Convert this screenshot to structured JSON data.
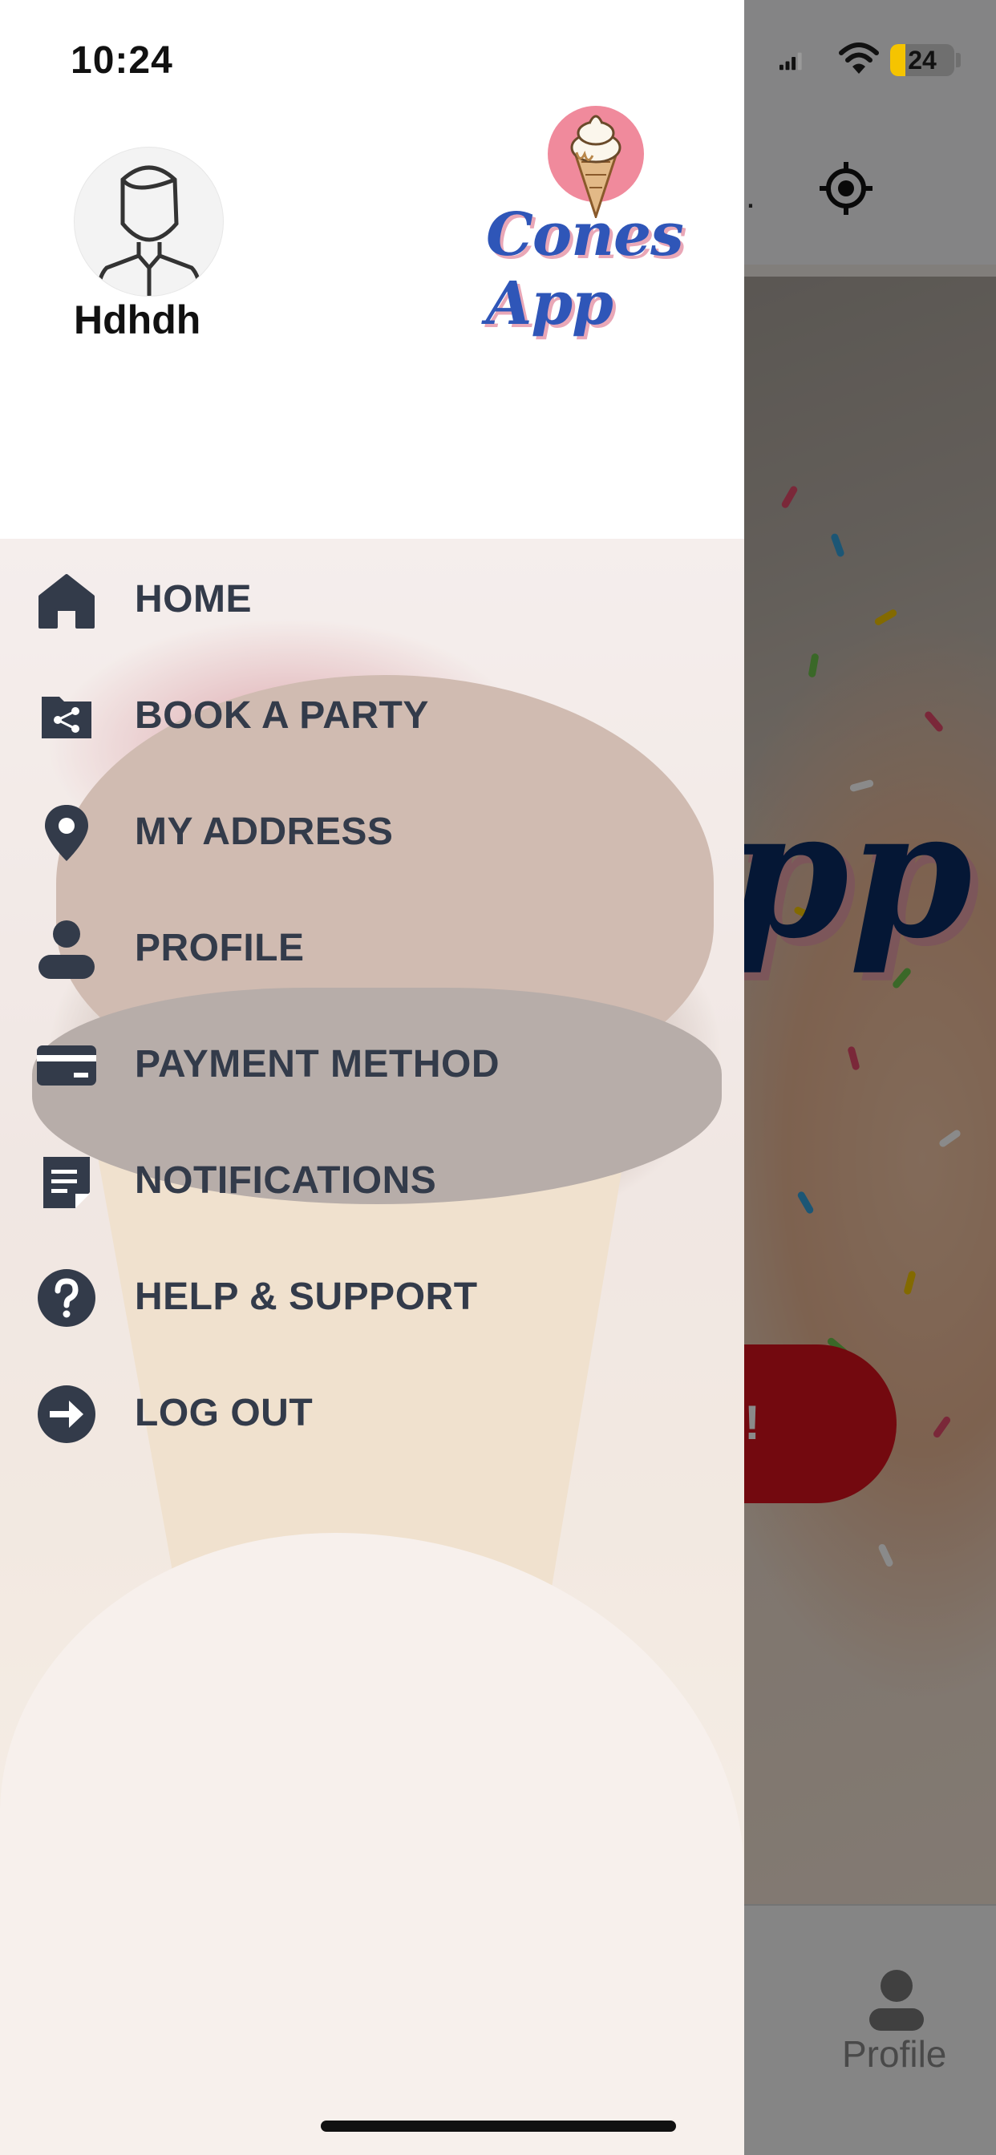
{
  "status_bar": {
    "time": "10:24",
    "battery_level": "24"
  },
  "user": {
    "name": "Hdhdh"
  },
  "brand": {
    "name": "Cones App"
  },
  "menu": {
    "items": [
      {
        "label": "HOME",
        "icon": "home-icon"
      },
      {
        "label": "BOOK A PARTY",
        "icon": "share-folder-icon"
      },
      {
        "label": "MY ADDRESS",
        "icon": "location-pin-icon"
      },
      {
        "label": "PROFILE",
        "icon": "person-icon"
      },
      {
        "label": "PAYMENT METHOD",
        "icon": "credit-card-icon"
      },
      {
        "label": "NOTIFICATIONS",
        "icon": "note-icon"
      },
      {
        "label": "HELP & SUPPORT",
        "icon": "help-circle-icon"
      },
      {
        "label": "LOG OUT",
        "icon": "logout-arrow-icon"
      }
    ]
  },
  "background": {
    "location_text": "…",
    "hero_logo_fragment": "pp",
    "cta_fragment": "!",
    "tabbar": {
      "profile_label": "Profile"
    }
  },
  "colors": {
    "menu_text": "#333b4a",
    "brand_blue": "#2f56b8",
    "cta_red": "#d5121c",
    "battery_yellow": "#f5c400"
  }
}
